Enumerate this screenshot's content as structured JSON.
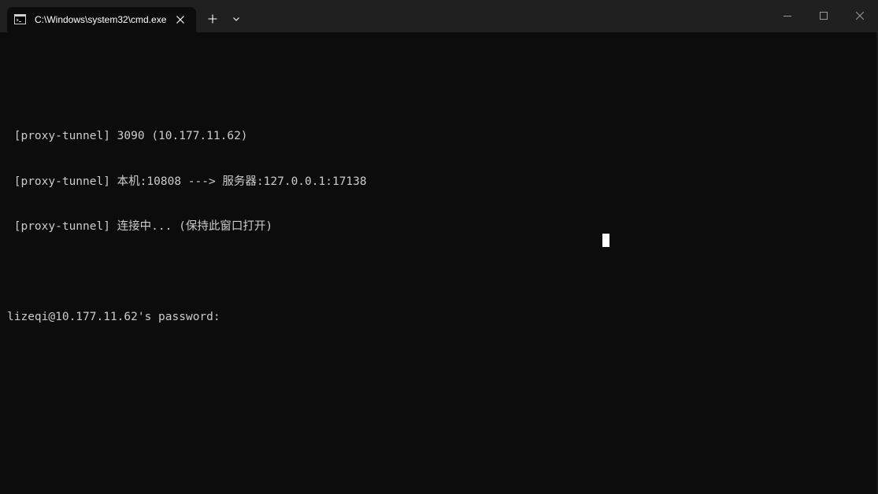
{
  "tab": {
    "title": "C:\\Windows\\system32\\cmd.exe",
    "icon": "cmd-icon"
  },
  "titlebar": {
    "new_tab_icon": "plus-icon",
    "dropdown_icon": "chevron-down-icon",
    "minimize_icon": "minimize-icon",
    "maximize_icon": "maximize-icon",
    "close_icon": "close-icon"
  },
  "terminal": {
    "lines": [
      "",
      " [proxy-tunnel] 3090 (10.177.11.62)",
      " [proxy-tunnel] 本机:10808 ---> 服务器:127.0.0.1:17138",
      " [proxy-tunnel] 连接中... (保持此窗口打开)",
      "",
      "lizeqi@10.177.11.62's password: "
    ]
  },
  "colors": {
    "background": "#0c0c0c",
    "titlebar": "#202020",
    "text": "#cccccc",
    "cursor": "#ffffff"
  }
}
